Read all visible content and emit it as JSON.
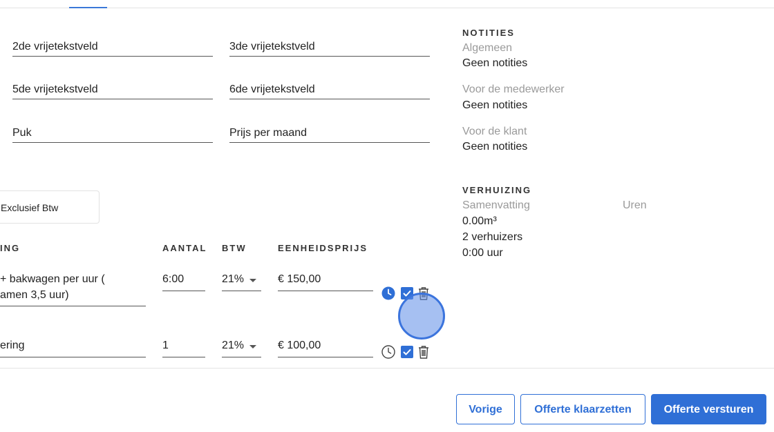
{
  "fields": {
    "field_2": "2de vrijetekstveld",
    "field_3": "3de vrijetekstveld",
    "field_5": "5de vrijetekstveld",
    "field_6": "6de vrijetekstveld",
    "field_puk": "Puk",
    "field_price": "Prijs per maand"
  },
  "btw_mode": "Exclusief Btw",
  "table": {
    "headers": {
      "description": "ING",
      "quantity": "AANTAL",
      "btw": "BTW",
      "unit_price": "EENHEIDSPRIJS"
    },
    "rows": [
      {
        "description_line1": "+ bakwagen per uur  (",
        "description_line2": "amen 3,5 uur)",
        "quantity": "6:00",
        "btw": "21%",
        "unit_price": "€ 150,00",
        "time_active": true,
        "checked": true
      },
      {
        "description_line1": "ering",
        "description_line2": "",
        "quantity": "1",
        "btw": "21%",
        "unit_price": "€ 100,00",
        "time_active": false,
        "checked": true
      }
    ]
  },
  "notes": {
    "title": "NOTITIES",
    "general_label": "Algemeen",
    "general_value": "Geen notities",
    "employee_label": "Voor de medewerker",
    "employee_value": "Geen notities",
    "customer_label": "Voor de klant",
    "customer_value": "Geen notities"
  },
  "moving": {
    "title": "VERHUIZING",
    "summary_label": "Samenvatting",
    "hours_label": "Uren",
    "volume": "0.00m³",
    "movers": "2 verhuizers",
    "time": "0:00 uur"
  },
  "buttons": {
    "previous": "Vorige",
    "prepare": "Offerte klaarzetten",
    "send": "Offerte versturen"
  },
  "colors": {
    "accent": "#2f6fd6",
    "muted": "#9a9a9a"
  }
}
